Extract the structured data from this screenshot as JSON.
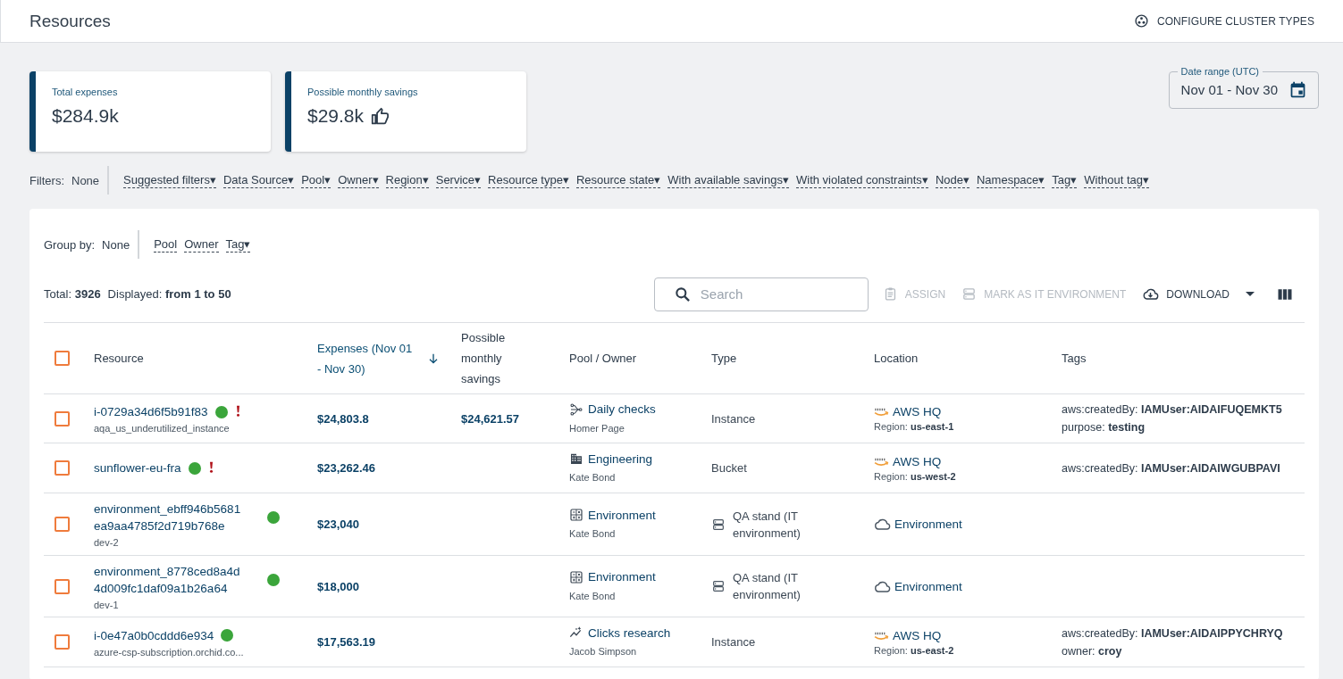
{
  "header": {
    "title": "Resources",
    "action": "CONFIGURE CLUSTER TYPES"
  },
  "summary_cards": [
    {
      "label": "Total expenses",
      "value": "$284.9k",
      "kind": "plain"
    },
    {
      "label": "Possible monthly savings",
      "value": "$29.8k",
      "kind": "savings"
    }
  ],
  "date_range": {
    "label": "Date range (UTC)",
    "value": "Nov 01 - Nov 30"
  },
  "filters": {
    "label": "Filters:",
    "value": "None",
    "options": [
      "Suggested filters▾",
      "Data Source▾",
      "Pool▾",
      "Owner▾",
      "Region▾",
      "Service▾",
      "Resource type▾",
      "Resource state▾",
      "With available savings▾",
      "With violated constraints▾",
      "Node▾",
      "Namespace▾",
      "Tag▾",
      "Without tag▾"
    ]
  },
  "group_by": {
    "label": "Group by:",
    "value": "None",
    "options": [
      "Pool",
      "Owner",
      "Tag▾"
    ]
  },
  "counts": {
    "total_label": "Total:",
    "total": "3926",
    "displayed_label": "Displayed:",
    "displayed": "from 1 to 50"
  },
  "toolbar": {
    "search": {
      "placeholder": "Search"
    },
    "actions": [
      {
        "label": "ASSIGN",
        "kind": "assign",
        "disabled": true
      },
      {
        "label": "MARK AS IT ENVIRONMENT",
        "kind": "mark",
        "disabled": true
      },
      {
        "label": "DOWNLOAD",
        "kind": "download",
        "disabled": false
      }
    ]
  },
  "table": {
    "select_all_checked": false,
    "columns": [
      {
        "label": "Resource",
        "sorted": false
      },
      {
        "label": "Expenses (Nov 01 - Nov 30)",
        "sorted": true
      },
      {
        "label": "Possible monthly savings",
        "sorted": false
      },
      {
        "label": "Pool / Owner",
        "sorted": false
      },
      {
        "label": "Type",
        "sorted": false
      },
      {
        "label": "Location",
        "sorted": false
      },
      {
        "label": "Tags",
        "sorted": false
      }
    ],
    "rows": [
      {
        "checked": false,
        "name": "i-0729a34d6f5b91f83",
        "subtitle": "aqa_us_underutilized_instance",
        "active": true,
        "warning": true,
        "expenses": "$24,803.8",
        "savings": "$24,621.57",
        "pool": {
          "name": "Daily checks",
          "kind": "checks"
        },
        "owner": "Homer Page",
        "type": {
          "label": "Instance",
          "kind": "plain"
        },
        "location": {
          "name": "AWS HQ",
          "kind": "aws",
          "region_label": "Region:",
          "region": "us-east-1"
        },
        "tags": [
          {
            "key": "aws:createdBy:",
            "value": "IAMUser:AIDAIFUQEMKT5"
          },
          {
            "key": "purpose:",
            "value": "testing"
          }
        ]
      },
      {
        "checked": false,
        "name": "sunflower-eu-fra",
        "active": true,
        "warning": true,
        "expenses": "$23,262.46",
        "pool": {
          "name": "Engineering",
          "kind": "business"
        },
        "owner": "Kate Bond",
        "type": {
          "label": "Bucket",
          "kind": "plain"
        },
        "location": {
          "name": "AWS HQ",
          "kind": "aws",
          "region_label": "Region:",
          "region": "us-west-2"
        },
        "tags": [
          {
            "key": "aws:createdBy:",
            "value": "IAMUser:AIDAIWGUBPAVI"
          }
        ]
      },
      {
        "checked": false,
        "name": "environment_ebff946b5681ea9aa4785f2d719b768e",
        "subtitle": "dev-2",
        "active": true,
        "warning": false,
        "expenses": "$23,040",
        "pool": {
          "name": "Environment",
          "kind": "calculator"
        },
        "owner": "Kate Bond",
        "type": {
          "label": "QA stand (IT environment)",
          "kind": "environment"
        },
        "location": {
          "name": "Environment",
          "kind": "environment"
        }
      },
      {
        "checked": false,
        "name": "environment_8778ced8a4d4d009fc1daf09a1b26a64",
        "subtitle": "dev-1",
        "active": true,
        "warning": false,
        "expenses": "$18,000",
        "pool": {
          "name": "Environment",
          "kind": "calculator"
        },
        "owner": "Kate Bond",
        "type": {
          "label": "QA stand (IT environment)",
          "kind": "environment"
        },
        "location": {
          "name": "Environment",
          "kind": "environment"
        }
      },
      {
        "checked": false,
        "name": "i-0e47a0b0cddd6e934",
        "subtitle": "azure-csp-subscription.orchid.co...",
        "active": true,
        "warning": false,
        "expenses": "$17,563.19",
        "pool": {
          "name": "Clicks research",
          "kind": "research"
        },
        "owner": "Jacob Simpson",
        "type": {
          "label": "Instance",
          "kind": "plain"
        },
        "location": {
          "name": "AWS HQ",
          "kind": "aws",
          "region_label": "Region:",
          "region": "us-east-2"
        },
        "tags": [
          {
            "key": "aws:createdBy:",
            "value": "IAMUser:AIDAIPPYCHRYQ"
          },
          {
            "key": "owner:",
            "value": "croy"
          }
        ]
      }
    ]
  }
}
